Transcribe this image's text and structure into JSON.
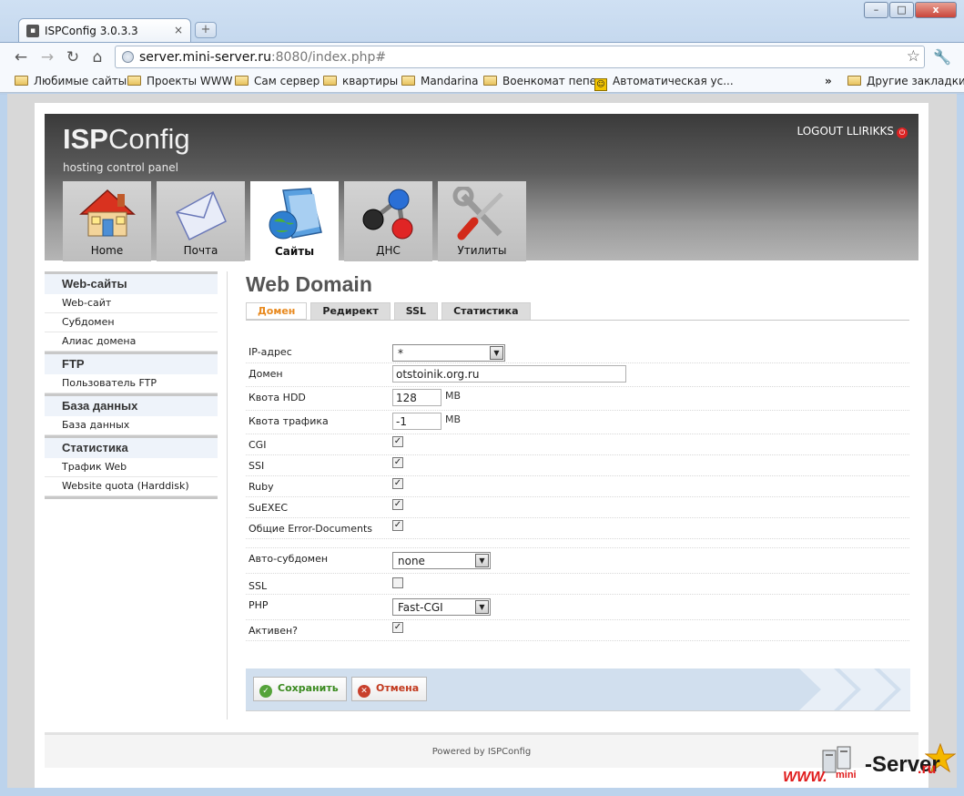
{
  "browser": {
    "tab_title": "ISPConfig 3.0.3.3",
    "tab_close": "×",
    "new_tab": "+",
    "url_host": "server.mini-server.ru",
    "url_rest": ":8080/index.php#",
    "window_buttons": {
      "minimize": "–",
      "maximize": "□",
      "close": "x"
    },
    "bookmarks": [
      "Любимые сайты",
      "Проекты WWW",
      "Сам сервер",
      "квартиры",
      "Mandarina",
      "Военкомат пепе",
      "Автоматическая ус..."
    ],
    "bookmarks_overflow": "»",
    "other_bookmarks": "Другие закладки"
  },
  "header": {
    "logo_isp": "ISP",
    "logo_config": "Config",
    "subtitle": "hosting control panel",
    "logout": "LOGOUT LLIRIKKS",
    "modules": [
      {
        "label": "Home",
        "icon": "house-icon"
      },
      {
        "label": "Почта",
        "icon": "envelope-icon"
      },
      {
        "label": "Сайты",
        "icon": "folder-globe-icon",
        "active": true
      },
      {
        "label": "ДНС",
        "icon": "molecule-icon"
      },
      {
        "label": "Утилиты",
        "icon": "tools-icon"
      }
    ]
  },
  "sidebar": {
    "sections": [
      {
        "title": "Web-сайты",
        "items": [
          "Web-сайт",
          "Субдомен",
          "Алиас домена"
        ]
      },
      {
        "title": "FTP",
        "items": [
          "Пользователь FTP"
        ]
      },
      {
        "title": "База данных",
        "items": [
          "База данных"
        ]
      },
      {
        "title": "Статистика",
        "items": [
          "Трафик Web",
          "Website quota (Harddisk)"
        ]
      }
    ]
  },
  "main": {
    "title": "Web Domain",
    "tabs": [
      "Домен",
      "Редирект",
      "SSL",
      "Статистика"
    ],
    "active_tab": "Домен",
    "fields": {
      "ip": {
        "label": "IP-адрес",
        "value": "*"
      },
      "domain": {
        "label": "Домен",
        "value": "otstoinik.org.ru"
      },
      "hdd": {
        "label": "Квота HDD",
        "value": "128",
        "unit": "MB"
      },
      "traffic": {
        "label": "Квота трафика",
        "value": "-1",
        "unit": "MB"
      },
      "cgi": {
        "label": "CGI",
        "checked": true
      },
      "ssi": {
        "label": "SSI",
        "checked": true
      },
      "ruby": {
        "label": "Ruby",
        "checked": true
      },
      "suexec": {
        "label": "SuEXEC",
        "checked": true
      },
      "errdocs": {
        "label": "Общие Error-Documents",
        "checked": true
      },
      "autosub": {
        "label": "Авто-субдомен",
        "value": "none"
      },
      "ssl": {
        "label": "SSL",
        "checked": false
      },
      "php": {
        "label": "PHP",
        "value": "Fast-CGI"
      },
      "active": {
        "label": "Активен?",
        "checked": true
      }
    },
    "save_label": "Сохранить",
    "cancel_label": "Отмена"
  },
  "footer": {
    "prefix": "Powered by ",
    "link": "ISPConfig"
  },
  "watermark": {
    "www": "WWW.",
    "mini": "mini",
    "server": "-Server",
    "ru": ".ru"
  },
  "colors": {
    "accent_tab": "#e8891e",
    "save": "#3a8a1f",
    "cancel": "#c23a1f"
  }
}
